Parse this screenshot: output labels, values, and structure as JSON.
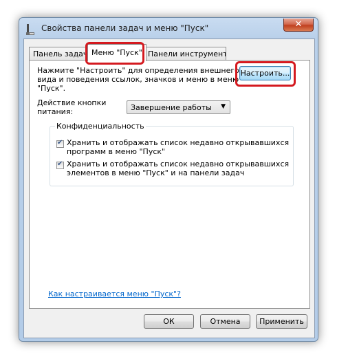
{
  "window": {
    "title": "Свойства панели задач и меню \"Пуск\"",
    "close_symbol": "✕"
  },
  "tabs": [
    {
      "label": "Панель задач",
      "active": false
    },
    {
      "label": "Меню \"Пуск\"",
      "active": true
    },
    {
      "label": "Панели инструментов",
      "active": false
    }
  ],
  "start_menu": {
    "description_lines": [
      "Нажмите \"Настроить\" для определения внешнего",
      "вида и поведения ссылок, значков и меню в меню",
      "\"Пуск\"."
    ],
    "customize_label": "Настроить...",
    "power_label_lines": [
      "Действие кнопки",
      "питания:"
    ],
    "power_value": "Завершение работы",
    "privacy": {
      "title": "Конфиденциальность",
      "items": [
        {
          "lines": [
            "Хранить и отображать список недавно открывавшихся",
            "программ в меню \"Пуск\""
          ],
          "checked": true
        },
        {
          "lines": [
            "Хранить и отображать список недавно открывавшихся",
            "элементов в меню \"Пуск\" и на панели задач"
          ],
          "checked": true
        }
      ]
    },
    "help_link": "Как настраивается меню \"Пуск\"?"
  },
  "buttons": {
    "ok": "ОК",
    "cancel": "Отмена",
    "apply": "Применить"
  },
  "colors": {
    "highlight": "#d4191f",
    "link": "#0066cc"
  }
}
